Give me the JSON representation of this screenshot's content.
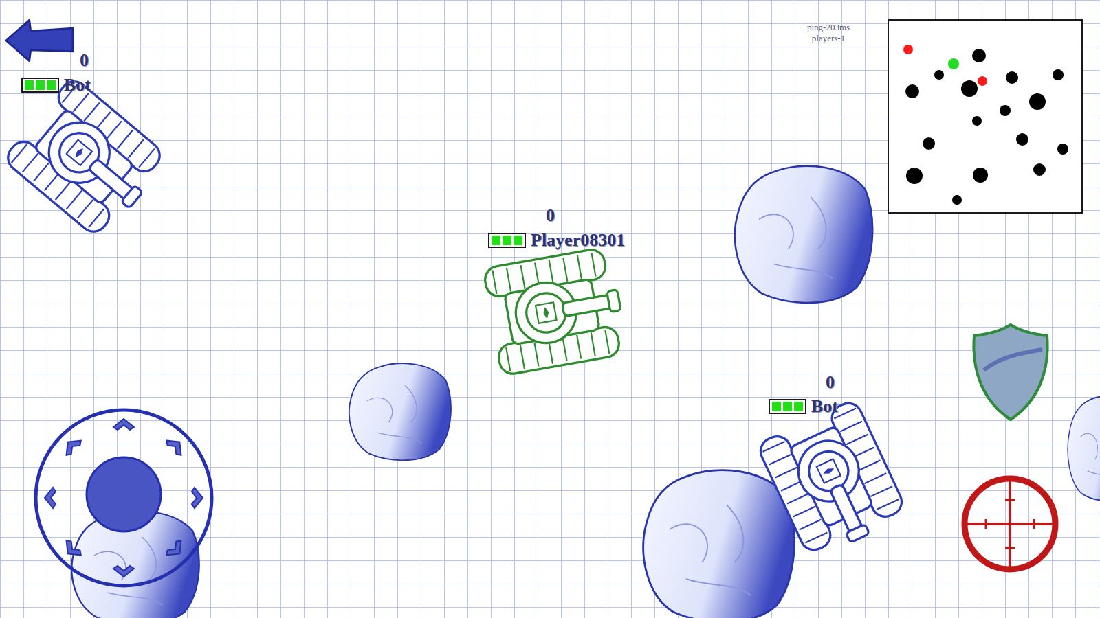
{
  "hud": {
    "ping": "ping-203ms",
    "players": "players-1"
  },
  "tanks": [
    {
      "name": "Bot",
      "score": "0",
      "health": 1,
      "player": false,
      "color": "#2b3bb8"
    },
    {
      "name": "Player08301",
      "score": "0",
      "health": 1,
      "player": true,
      "color": "#2e8b2e"
    },
    {
      "name": "Bot",
      "score": "0",
      "health": 1,
      "player": false,
      "color": "#2b3bb8"
    }
  ],
  "minimap": {
    "markers": [
      {
        "kind": "enemy",
        "color": "#ff1a1a"
      },
      {
        "kind": "player",
        "color": "#22dd22"
      },
      {
        "kind": "enemy",
        "color": "#ff1a1a"
      },
      {
        "kind": "rock",
        "color": "#000000"
      },
      {
        "kind": "rock",
        "color": "#000000"
      },
      {
        "kind": "rock",
        "color": "#000000"
      },
      {
        "kind": "rock",
        "color": "#000000"
      },
      {
        "kind": "rock",
        "color": "#000000"
      },
      {
        "kind": "rock",
        "color": "#000000"
      },
      {
        "kind": "rock",
        "color": "#000000"
      },
      {
        "kind": "rock",
        "color": "#000000"
      },
      {
        "kind": "rock",
        "color": "#000000"
      },
      {
        "kind": "rock",
        "color": "#000000"
      },
      {
        "kind": "rock",
        "color": "#000000"
      },
      {
        "kind": "rock",
        "color": "#000000"
      },
      {
        "kind": "rock",
        "color": "#000000"
      },
      {
        "kind": "rock",
        "color": "#000000"
      },
      {
        "kind": "rock",
        "color": "#000000"
      },
      {
        "kind": "rock",
        "color": "#000000"
      }
    ]
  }
}
